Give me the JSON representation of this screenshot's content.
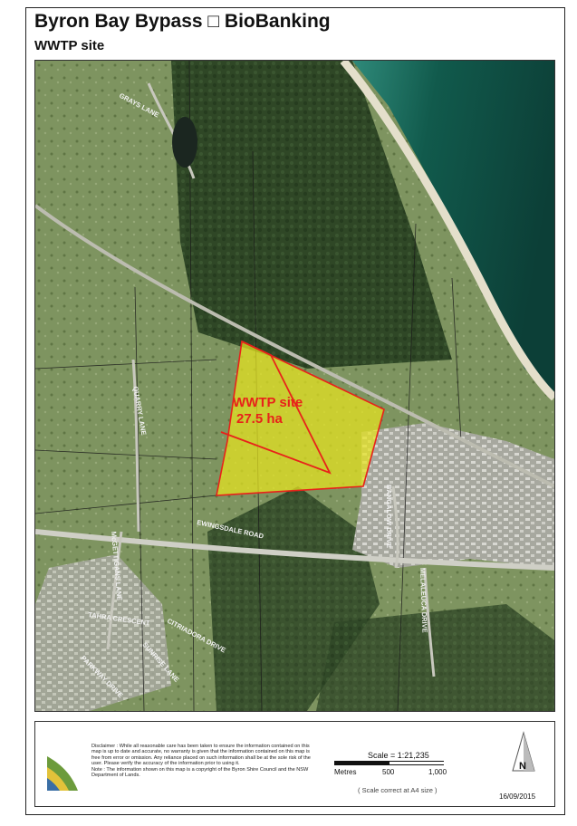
{
  "title": "Byron Bay Bypass □ BioBanking",
  "subtitle": "WWTP site",
  "map": {
    "site_label_line1": "WWTP site",
    "site_label_line2": "27.5 ha",
    "site_outline_color": "#e8221a",
    "site_fill_color": "#e8e41e",
    "roads": [
      "GRAYS LANE",
      "QUARRY LANE",
      "EWINGSDALE ROAD",
      "McGETTIGANS LANE",
      "BANGALOW DRIVE",
      "MELALEUCA DRIVE",
      "TAHRA CRESCENT",
      "CITRIADORA DRIVE",
      "SUNRISE LANE",
      "PARKWAY DRIVE"
    ]
  },
  "footer": {
    "disclaimer": "Disclaimer : While all reasonable care has been taken to ensure the information contained on this map is up to date and accurate, no warranty is given that the information contained on this map is free from error or omission. Any reliance placed on such information shall be at the sole risk of the user. Please verify the accuracy of the information prior to using it.\nNote : The information shown on this map is a copyright of the Byron Shire Council and the NSW Department of Lands.",
    "scale_title": "Scale = 1:21,235",
    "scale_labels": [
      "Metres",
      "500",
      "1,000"
    ],
    "scale_note": "( Scale correct at A4 size )",
    "date": "16/09/2015",
    "north_label": "N"
  }
}
